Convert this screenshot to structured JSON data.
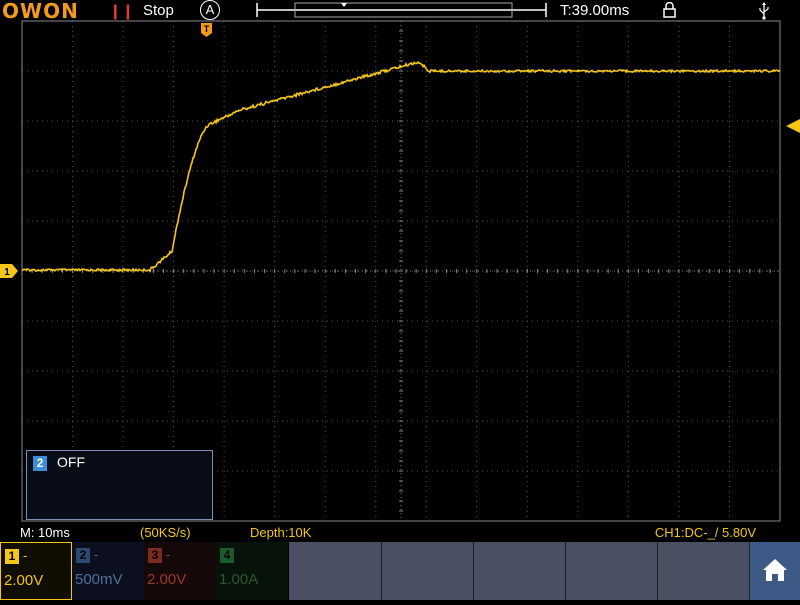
{
  "topbar": {
    "logo": "OWON",
    "run_icon": "pause-icon",
    "run_status": "Stop",
    "trigger_mode": "A",
    "time_readout": "T:39.00ms",
    "lock_icon": "lock-icon",
    "usb_icon": "usb-icon"
  },
  "markers": {
    "trigger_position": "T",
    "ch1_ground": "1"
  },
  "ch2_popup": {
    "badge": "2",
    "text": "OFF"
  },
  "infobar": {
    "timebase": "M: 10ms",
    "sample_rate": "(50KS/s)",
    "depth": "Depth:10K",
    "trigger": "CH1:DC-_/ 5.80V"
  },
  "channels": [
    {
      "badge": "1",
      "coupling": "-",
      "scale": "2.00V",
      "color": "#f5c518"
    },
    {
      "badge": "2",
      "coupling": "-",
      "scale": "500mV",
      "color": "#3d8cd8"
    },
    {
      "badge": "3",
      "coupling": "-",
      "scale": "2.00V",
      "color": "#c0442e"
    },
    {
      "badge": "4",
      "coupling": "",
      "scale": "1.00A",
      "color": "#2e8a3c"
    }
  ],
  "home_icon": "home-icon",
  "colors": {
    "ch1": "#f5c518",
    "logo": "#f39a1e",
    "run_status": "#e53935",
    "softkey": "#4a4f62",
    "home": "#3d5a86"
  }
}
